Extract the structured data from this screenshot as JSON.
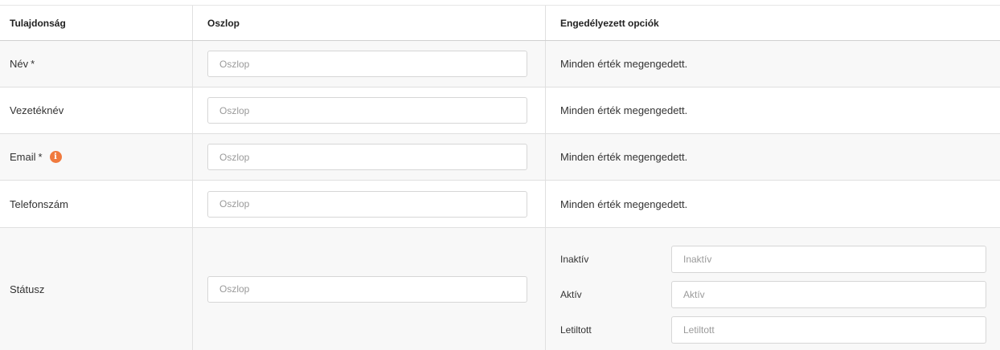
{
  "headers": {
    "property": "Tulajdonság",
    "column": "Oszlop",
    "allowed": "Engedélyezett opciók"
  },
  "rows": [
    {
      "label": "Név",
      "required": "*",
      "column_placeholder": "Oszlop",
      "allowed": "Minden érték megengedett."
    },
    {
      "label": "Vezetéknév",
      "required": "",
      "column_placeholder": "Oszlop",
      "allowed": "Minden érték megengedett."
    },
    {
      "label": "Email",
      "required": "*",
      "info_icon": "info-icon",
      "column_placeholder": "Oszlop",
      "allowed": "Minden érték megengedett."
    },
    {
      "label": "Telefonszám",
      "required": "",
      "column_placeholder": "Oszlop",
      "allowed": "Minden érték megengedett."
    },
    {
      "label": "Státusz",
      "required": "",
      "column_placeholder": "Oszlop",
      "options": [
        {
          "label": "Inaktív",
          "placeholder": "Inaktív"
        },
        {
          "label": "Aktív",
          "placeholder": "Aktív"
        },
        {
          "label": "Letiltott",
          "placeholder": "Letiltott"
        }
      ]
    }
  ],
  "colors": {
    "info_icon": "#f07a3e",
    "row_shade": "#f8f8f8",
    "border": "#e0e0e0"
  }
}
